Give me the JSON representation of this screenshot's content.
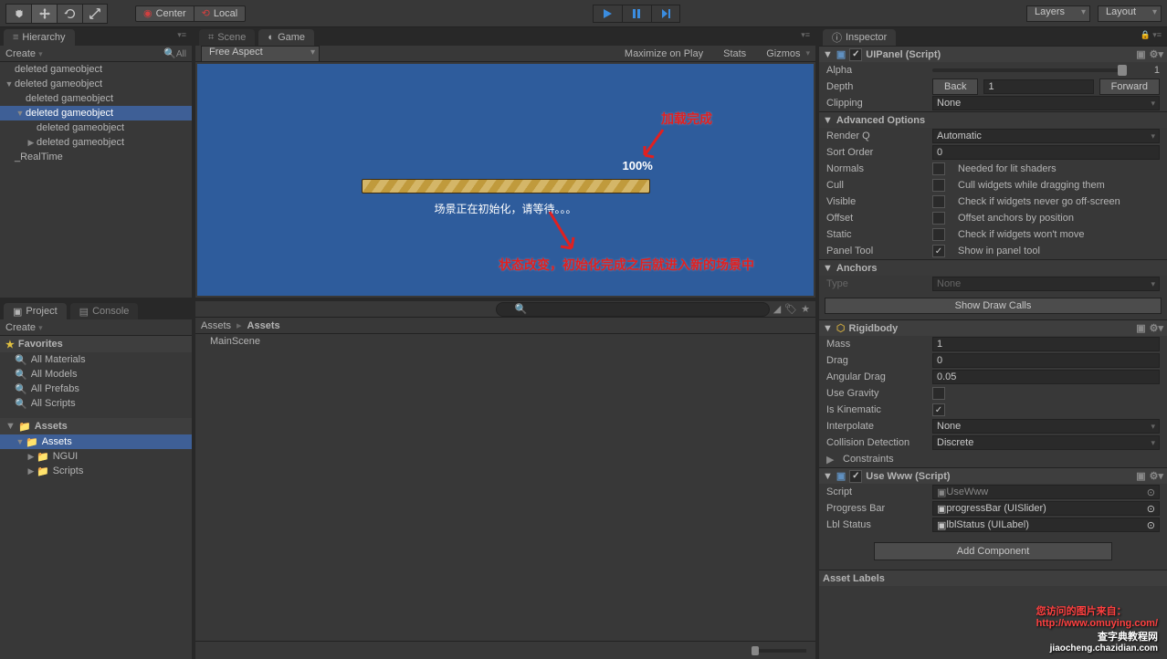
{
  "toolbar": {
    "center": "Center",
    "local": "Local",
    "layers": "Layers",
    "layout": "Layout"
  },
  "hierarchy": {
    "tab": "Hierarchy",
    "create": "Create",
    "all": "All",
    "items": [
      {
        "label": "deleted gameobject",
        "indent": 0,
        "arrow": ""
      },
      {
        "label": "deleted gameobject",
        "indent": 0,
        "arrow": "▼"
      },
      {
        "label": "deleted gameobject",
        "indent": 1,
        "arrow": ""
      },
      {
        "label": "deleted gameobject",
        "indent": 1,
        "arrow": "▼",
        "sel": true
      },
      {
        "label": "deleted gameobject",
        "indent": 2,
        "arrow": ""
      },
      {
        "label": "deleted gameobject",
        "indent": 2,
        "arrow": "▶"
      },
      {
        "label": "_RealTime",
        "indent": 0,
        "arrow": ""
      }
    ]
  },
  "scene_tab": "Scene",
  "game_tab": "Game",
  "game_bar": {
    "aspect": "Free Aspect",
    "maximize": "Maximize on Play",
    "stats": "Stats",
    "gizmos": "Gizmos"
  },
  "game_view": {
    "percent": "100%",
    "status": "场景正在初始化，请等待。。。",
    "anno1": "加载完成",
    "anno2": "状态改变，初始化完成之后就进入新的场景中"
  },
  "project": {
    "tab": "Project",
    "console": "Console",
    "create": "Create",
    "favorites": "Favorites",
    "fav_items": [
      "All Materials",
      "All Models",
      "All Prefabs",
      "All Scripts"
    ],
    "assets": "Assets",
    "asset_items": [
      "Assets",
      "NGUI",
      "Scripts"
    ],
    "breadcrumb": [
      "Assets",
      "Assets"
    ],
    "main_items": [
      "MainScene"
    ]
  },
  "inspector": {
    "tab": "Inspector",
    "uipanel": {
      "title": "UIPanel (Script)",
      "alpha": "Alpha",
      "alpha_val": "1",
      "depth": "Depth",
      "back": "Back",
      "forward": "Forward",
      "depth_val": "1",
      "clipping": "Clipping",
      "clipping_val": "None",
      "adv": "Advanced Options",
      "renderq": "Render Q",
      "renderq_val": "Automatic",
      "sort": "Sort Order",
      "sort_val": "0",
      "normals": "Normals",
      "normals_txt": "Needed for lit shaders",
      "cull": "Cull",
      "cull_txt": "Cull widgets while dragging them",
      "visible": "Visible",
      "visible_txt": "Check if widgets never go off-screen",
      "offset": "Offset",
      "offset_txt": "Offset anchors by position",
      "static": "Static",
      "static_txt": "Check if widgets won't move",
      "paneltool": "Panel Tool",
      "paneltool_txt": "Show in panel tool",
      "anchors": "Anchors",
      "type": "Type",
      "type_val": "None",
      "showdraw": "Show Draw Calls"
    },
    "rigidbody": {
      "title": "Rigidbody",
      "mass": "Mass",
      "mass_val": "1",
      "drag": "Drag",
      "drag_val": "0",
      "angular": "Angular Drag",
      "angular_val": "0.05",
      "gravity": "Use Gravity",
      "kinematic": "Is Kinematic",
      "interp": "Interpolate",
      "interp_val": "None",
      "coll": "Collision Detection",
      "coll_val": "Discrete",
      "constraints": "Constraints"
    },
    "usewww": {
      "title": "Use Www (Script)",
      "script": "Script",
      "script_val": "UseWww",
      "progress": "Progress Bar",
      "progress_val": "progressBar (UISlider)",
      "lbl": "Lbl Status",
      "lbl_val": "lblStatus (UILabel)"
    },
    "addcomp": "Add Component",
    "assetlabels": "Asset Labels"
  },
  "watermark": {
    "line1": "您访问的图片来自：",
    "line2": "http://www.omuying.com/",
    "line3": "查字典教程网",
    "line4": "jiaocheng.chazidian.com"
  }
}
